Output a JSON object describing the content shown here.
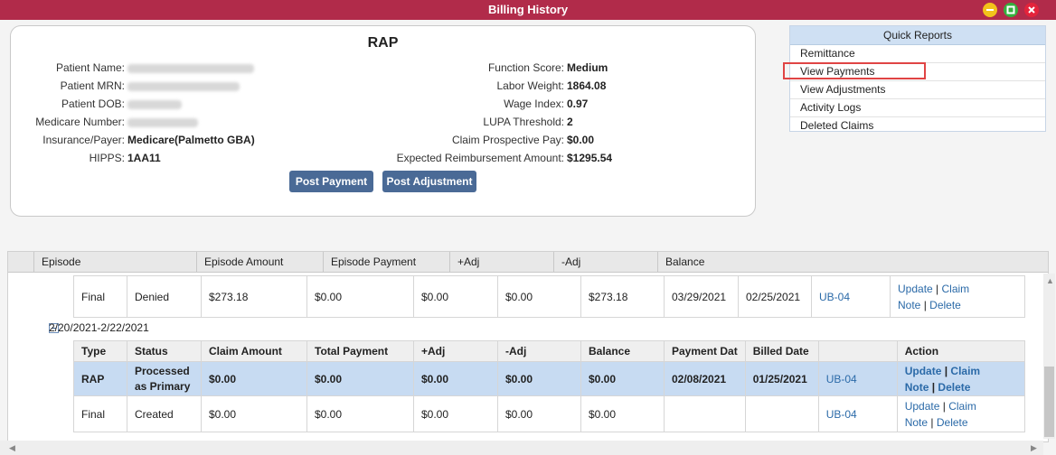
{
  "window": {
    "title": "Billing History"
  },
  "claim_card": {
    "title": "RAP",
    "left_fields": [
      {
        "label": "Patient Name:",
        "value": ""
      },
      {
        "label": "Patient MRN:",
        "value": ""
      },
      {
        "label": "Patient DOB:",
        "value": ""
      },
      {
        "label": "Medicare Number:",
        "value": ""
      },
      {
        "label": "Insurance/Payer:",
        "value": "Medicare(Palmetto GBA)"
      },
      {
        "label": "HIPPS:",
        "value": "1AA11"
      }
    ],
    "right_fields": [
      {
        "label": "Function Score:",
        "value": "Medium"
      },
      {
        "label": "Labor Weight:",
        "value": "1864.08"
      },
      {
        "label": "Wage Index:",
        "value": "0.97"
      },
      {
        "label": "LUPA Threshold:",
        "value": "2"
      },
      {
        "label": "Claim Prospective Pay:",
        "value": "$0.00"
      },
      {
        "label": "Expected Reimbursement Amount:",
        "value": "$1295.54"
      }
    ],
    "buttons": {
      "post_payment": "Post Payment",
      "post_adjustment": "Post Adjustment"
    }
  },
  "quick_reports": {
    "title": "Quick Reports",
    "items": [
      "Remittance",
      "View Payments",
      "View Adjustments",
      "Activity Logs",
      "Deleted Claims"
    ],
    "highlighted": "View Payments"
  },
  "grid": {
    "headers": [
      "Episode",
      "Episode Amount",
      "Episode Payment",
      "+Adj",
      "-Adj",
      "Balance"
    ],
    "prior_row": {
      "type": "Final",
      "status": "Denied",
      "claim_amount": "$273.18",
      "total_payment": "$0.00",
      "plus_adj": "$0.00",
      "minus_adj": "$0.00",
      "balance": "$273.18",
      "payment_date": "03/29/2021",
      "billed_date": "02/25/2021",
      "form": "UB-04",
      "action_1": "Update",
      "action_2": "Claim",
      "action_3": "Note",
      "action_4": "Delete"
    },
    "episode": {
      "range": "2/20/2021-2/22/2021",
      "sub_headers": [
        "Type",
        "Status",
        "Claim Amount",
        "Total Payment",
        "+Adj",
        "-Adj",
        "Balance",
        "Payment Dat",
        "Billed Date",
        "",
        "Action"
      ],
      "rows": [
        {
          "type": "RAP",
          "status": "Processed as Primary",
          "claim_amount": "$0.00",
          "total_payment": "$0.00",
          "plus_adj": "$0.00",
          "minus_adj": "$0.00",
          "balance": "$0.00",
          "payment_date": "02/08/2021",
          "billed_date": "01/25/2021",
          "form": "UB-04",
          "action_1": "Update",
          "action_2": "Claim",
          "action_3": "Note",
          "action_4": "Delete"
        },
        {
          "type": "Final",
          "status": "Created",
          "claim_amount": "$0.00",
          "total_payment": "$0.00",
          "plus_adj": "$0.00",
          "minus_adj": "$0.00",
          "balance": "$0.00",
          "payment_date": "",
          "billed_date": "",
          "form": "UB-04",
          "action_1": "Update",
          "action_2": "Claim",
          "action_3": "Note",
          "action_4": "Delete"
        }
      ]
    }
  },
  "colors": {
    "title_bar": "#b12b4a",
    "button": "#4a6a96",
    "selected_row": "#c7dbf2",
    "link": "#2b6aa8",
    "highlight_box": "#e04444"
  }
}
